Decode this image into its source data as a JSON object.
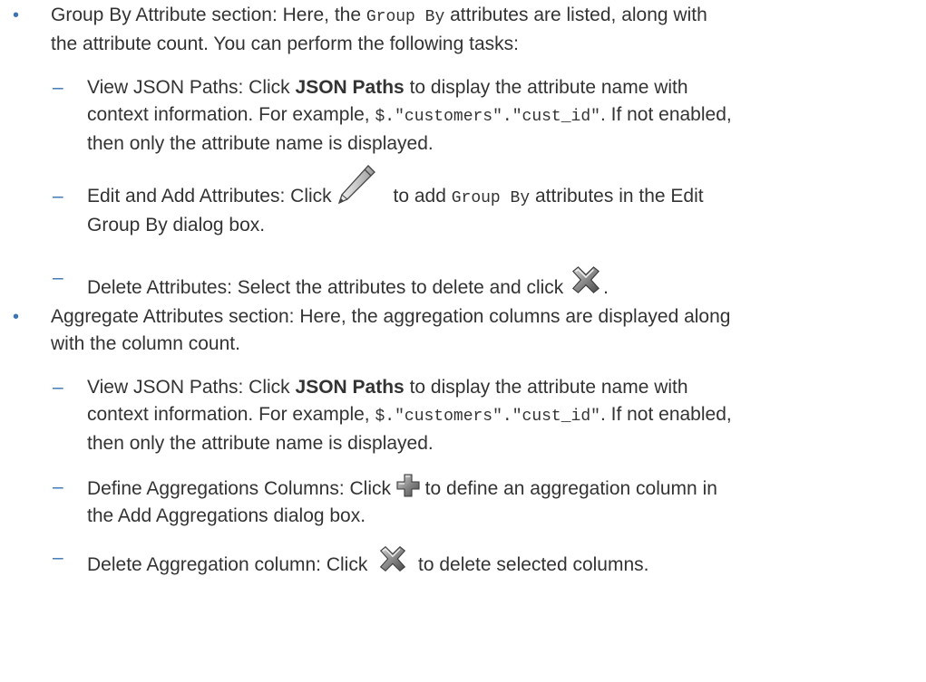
{
  "group_by": {
    "intro_before": "Group By Attribute section: Here, the ",
    "intro_code": "Group By",
    "intro_after_line1": " attributes are listed, along with",
    "intro_line2": "the attribute count. You can perform the following tasks:",
    "view_json": {
      "lead": "View JSON Paths: Click ",
      "strong": "JSON Paths",
      "after": " to display the attribute name with",
      "line2_before": "context information. For example, ",
      "line2_code": "$.\"customers\".\"cust_id\"",
      "line2_after": ". If not enabled,",
      "line3": "then only the attribute name is displayed."
    },
    "edit_add": {
      "lead": "Edit and Add Attributes: Click ",
      "icon": "pencil-icon",
      "mid": "to add ",
      "code": "Group By",
      "after": " attributes in the Edit",
      "line2": "Group By dialog box."
    },
    "delete_attrs": {
      "lead": "Delete Attributes: Select the attributes to delete and click ",
      "icon": "delete-x-icon",
      "tail": "."
    }
  },
  "aggregate": {
    "intro_line1": "Aggregate Attributes section: Here, the aggregation columns are displayed along",
    "intro_line2": "with the column count.",
    "view_json": {
      "lead": "View JSON Paths: Click ",
      "strong": "JSON Paths",
      "after": " to display the attribute name with",
      "line2_before": "context information. For example, ",
      "line2_code": "$.\"customers\".\"cust_id\"",
      "line2_after": ". If not enabled,",
      "line3": "then only the attribute name is displayed."
    },
    "define_columns": {
      "lead": "Define Aggregations Columns: Click ",
      "icon": "add-plus-icon",
      "after": " to define an aggregation column in",
      "line2": "the Add Aggregations dialog box."
    },
    "delete_column": {
      "lead": "Delete Aggregation column: Click ",
      "icon": "delete-x-icon",
      "after": " to delete selected columns."
    }
  },
  "markers": {
    "bullet": "•",
    "dash": "–"
  },
  "colors": {
    "text": "#333333",
    "marker": "#3c75b4"
  }
}
